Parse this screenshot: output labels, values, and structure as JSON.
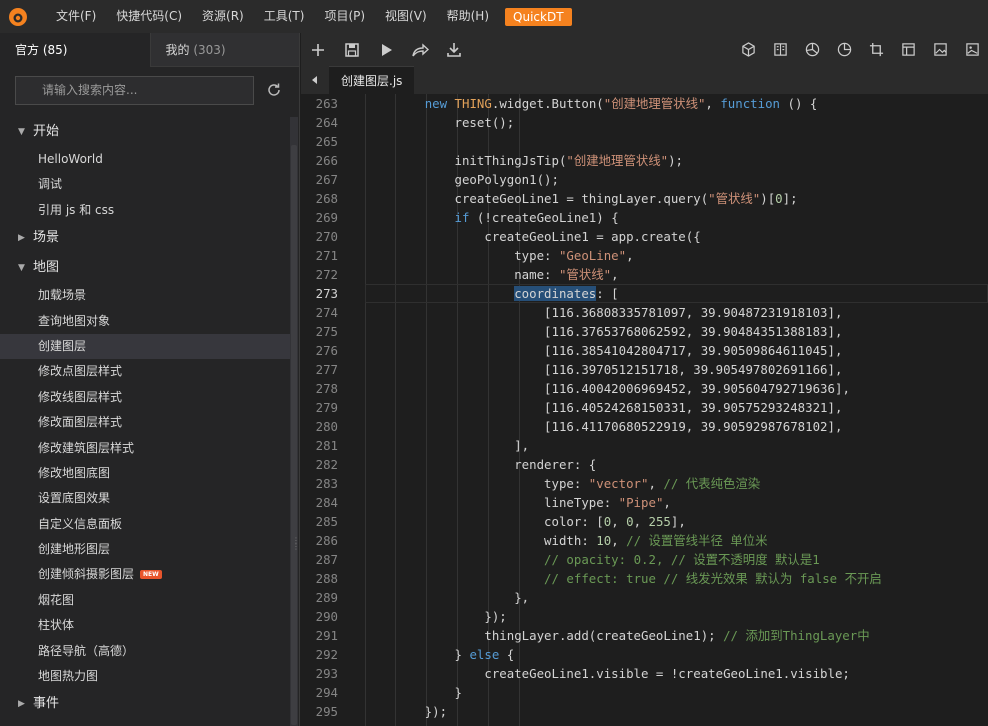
{
  "menubar": {
    "logo_icon": "thingjs-logo-icon",
    "items": [
      "文件(F)",
      "快捷代码(C)",
      "资源(R)",
      "工具(T)",
      "项目(P)",
      "视图(V)",
      "帮助(H)"
    ],
    "quick": "QuickDT",
    "accent": "#f5821f"
  },
  "sidebar": {
    "tab_official": "官方",
    "tab_official_count": "(85)",
    "tab_mine": "我的",
    "tab_mine_count": "(303)",
    "search_placeholder": "请输入搜索内容...",
    "cat_start": "开始",
    "start_items": [
      "HelloWorld",
      "调试",
      "引用 js 和 css"
    ],
    "cat_scene": "场景",
    "cat_map": "地图",
    "map_items": [
      "加载场景",
      "查询地图对象",
      "创建图层",
      "修改点图层样式",
      "修改线图层样式",
      "修改面图层样式",
      "修改建筑图层样式",
      "修改地图底图",
      "设置底图效果",
      "自定义信息面板",
      "创建地形图层",
      "创建倾斜摄影图层",
      "烟花图",
      "柱状体",
      "路径导航（高德）",
      "地图热力图"
    ],
    "new_badge": "NEW",
    "cat_event": "事件"
  },
  "toolbar": {
    "left_icons": [
      "add-icon",
      "save-icon",
      "run-icon",
      "share-icon",
      "download-icon"
    ],
    "right_icons": [
      "cube-icon",
      "book-icon",
      "chart-icon",
      "pie-icon",
      "crop-icon",
      "layout-icon",
      "image-icon",
      "picture-icon"
    ]
  },
  "tabbar": {
    "file_name": "创建图层.js"
  },
  "editor": {
    "current_line": 273,
    "line_numbers": [
      "263",
      "264",
      "265",
      "266",
      "267",
      "268",
      "269",
      "270",
      "271",
      "272",
      "273",
      "274",
      "275",
      "276",
      "277",
      "278",
      "279",
      "280",
      "281",
      "282",
      "283",
      "284",
      "285",
      "286",
      "287",
      "288",
      "289",
      "290",
      "291",
      "292",
      "293",
      "294",
      "295"
    ],
    "coords": [
      "[116.36808335781097, 39.90487231918103],",
      "[116.37653768062592, 39.90484351388183],",
      "[116.38541042804717, 39.90509864611045],",
      "[116.3970512151718, 39.905497802691166],",
      "[116.40042006969452, 39.905604792719636],",
      "[116.40524268150331, 39.90575293248321],",
      "[116.41170680522919, 39.90592987678102],"
    ],
    "s_button_label": "\"创建地理管状线\"",
    "s_tip": "\"创建地理管状线\"",
    "s_query": "\"管状线\"",
    "s_type": "\"GeoLine\"",
    "s_name": "\"管状线\"",
    "s_vector": "\"vector\"",
    "s_pipe": "\"Pipe\"",
    "c_vector": "// 代表纯色渲染",
    "c_width": "// 设置管线半径 单位米",
    "c_opacity": "// opacity: 0.2, // 设置不透明度 默认是1",
    "c_effect": "// effect: true // 线发光效果 默认为 false 不开启",
    "c_add": "// 添加到ThingLayer中"
  }
}
